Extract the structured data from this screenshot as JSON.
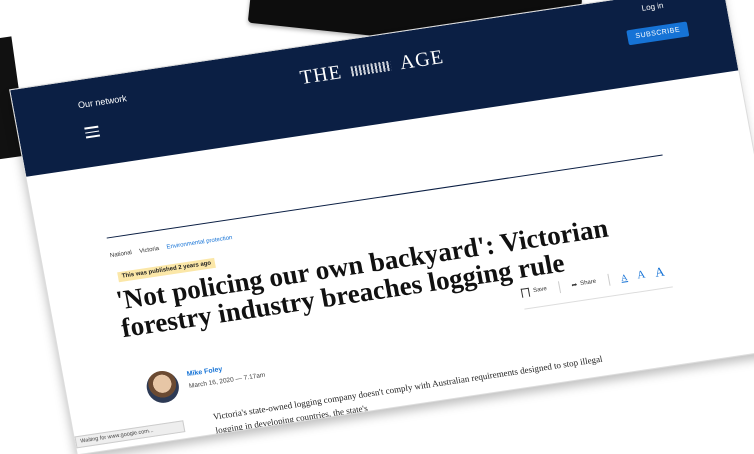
{
  "header": {
    "our_network": "Our network",
    "logo_left": "THE",
    "logo_right": "AGE",
    "login": "Log in",
    "subscribe": "SUBSCRIBE"
  },
  "breadcrumb": [
    "National",
    "Victoria",
    "Environmental protection"
  ],
  "published_badge": "This was published 2 years ago",
  "headline": "'Not policing our own backyard': Victorian forestry industry breaches logging rule",
  "tools": {
    "save": "Save",
    "share": "Share",
    "font_small": "A",
    "font_medium": "A",
    "font_large": "A"
  },
  "author": {
    "name": "Mike Foley",
    "date": "March 16, 2020 — 7.17am"
  },
  "body": "Victoria's state-owned logging company doesn't comply with Australian requirements designed to stop illegal logging in developing countries, the state's",
  "status_bar": "Waiting for www.google.com..."
}
